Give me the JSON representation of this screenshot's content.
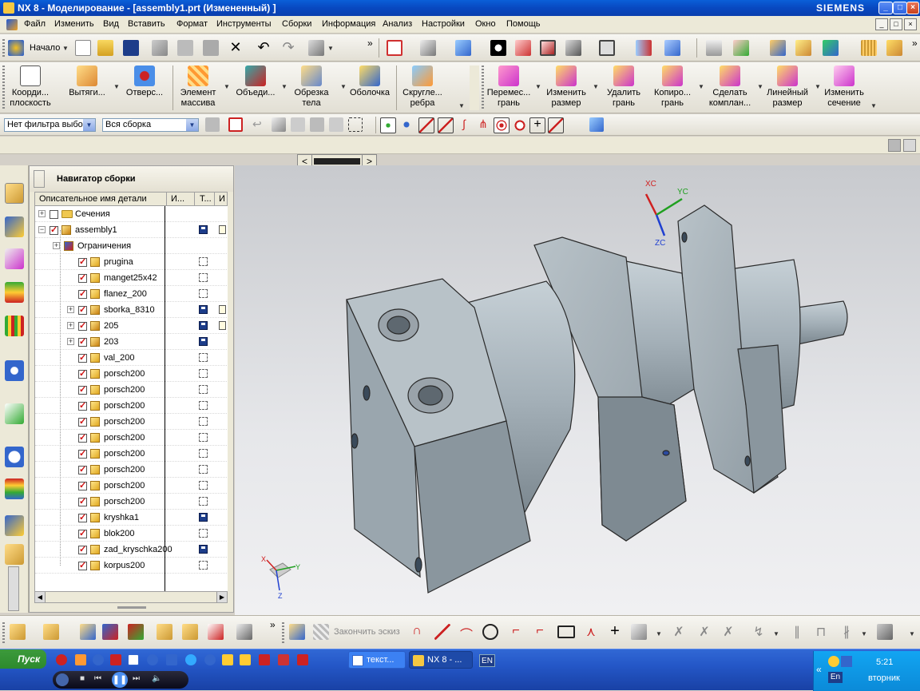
{
  "title_bar": {
    "title": "NX 8 - Моделирование - [assembly1.prt (Измененный) ]",
    "brand": "SIEMENS",
    "min": "_",
    "max": "□",
    "close": "×"
  },
  "menu": {
    "items": [
      "Файл",
      "Изменить",
      "Вид",
      "Вставить",
      "Формат",
      "Инструменты",
      "Сборки",
      "Информация",
      "Анализ",
      "Настройки",
      "Окно",
      "Помощь"
    ]
  },
  "toolbar1": {
    "start_label": "Начало",
    "more": "»"
  },
  "toolbar2": {
    "buttons": [
      {
        "label": "Коорди...\nплоскость"
      },
      {
        "label": "Вытяги..."
      },
      {
        "label": "Отверс..."
      },
      {
        "label": "Элемент\nмассива"
      },
      {
        "label": "Объеди..."
      },
      {
        "label": "Обрезка\nтела"
      },
      {
        "label": "Оболочка"
      },
      {
        "label": "Скругле...\nребра"
      },
      {
        "label": "Перемес...\nгрань"
      },
      {
        "label": "Изменить\nразмер"
      },
      {
        "label": "Удалить\nгрань"
      },
      {
        "label": "Копиро...\nгрань"
      },
      {
        "label": "Сделать\nкомплан..."
      },
      {
        "label": "Линейный\nразмер"
      },
      {
        "label": "Изменить\nсечение"
      }
    ]
  },
  "selection_bar": {
    "filter": "Нет фильтра выбо",
    "scope": "Вся сборка"
  },
  "navigator": {
    "title": "Навигатор сборки",
    "columns": [
      "Описательное имя детали",
      "И...",
      "Т...",
      "И"
    ],
    "rows": [
      {
        "name": "Сечения",
        "kind": "folder",
        "checked": false,
        "expander": "+",
        "status": "",
        "doc": false
      },
      {
        "name": "assembly1",
        "kind": "asm",
        "checked": true,
        "expander": "−",
        "status": "save",
        "doc": true
      },
      {
        "name": "Ограничения",
        "kind": "constraint",
        "checked": false,
        "expander": "+",
        "status": "",
        "doc": false
      },
      {
        "name": "prugina",
        "kind": "part",
        "checked": true,
        "expander": "",
        "status": "empty",
        "doc": false
      },
      {
        "name": "manget25x42",
        "kind": "part",
        "checked": true,
        "expander": "",
        "status": "empty",
        "doc": false
      },
      {
        "name": "flanez_200",
        "kind": "part",
        "checked": true,
        "expander": "",
        "status": "empty",
        "doc": false
      },
      {
        "name": "sborka_8310",
        "kind": "asm",
        "checked": true,
        "expander": "+",
        "status": "save",
        "doc": true
      },
      {
        "name": "205",
        "kind": "asm",
        "checked": true,
        "expander": "+",
        "status": "save",
        "doc": true
      },
      {
        "name": "203",
        "kind": "asm",
        "checked": true,
        "expander": "+",
        "status": "save",
        "doc": false
      },
      {
        "name": "val_200",
        "kind": "part",
        "checked": true,
        "expander": "",
        "status": "empty",
        "doc": false
      },
      {
        "name": "porsch200",
        "kind": "part",
        "checked": true,
        "expander": "",
        "status": "empty",
        "doc": false
      },
      {
        "name": "porsch200",
        "kind": "part",
        "checked": true,
        "expander": "",
        "status": "empty",
        "doc": false
      },
      {
        "name": "porsch200",
        "kind": "part",
        "checked": true,
        "expander": "",
        "status": "empty",
        "doc": false
      },
      {
        "name": "porsch200",
        "kind": "part",
        "checked": true,
        "expander": "",
        "status": "empty",
        "doc": false
      },
      {
        "name": "porsch200",
        "kind": "part",
        "checked": true,
        "expander": "",
        "status": "empty",
        "doc": false
      },
      {
        "name": "porsch200",
        "kind": "part",
        "checked": true,
        "expander": "",
        "status": "empty",
        "doc": false
      },
      {
        "name": "porsch200",
        "kind": "part",
        "checked": true,
        "expander": "",
        "status": "empty",
        "doc": false
      },
      {
        "name": "porsch200",
        "kind": "part",
        "checked": true,
        "expander": "",
        "status": "empty",
        "doc": false
      },
      {
        "name": "porsch200",
        "kind": "part",
        "checked": true,
        "expander": "",
        "status": "empty",
        "doc": false
      },
      {
        "name": "kryshka1",
        "kind": "part",
        "checked": true,
        "expander": "",
        "status": "save",
        "doc": false
      },
      {
        "name": "blok200",
        "kind": "part",
        "checked": true,
        "expander": "",
        "status": "empty",
        "doc": false
      },
      {
        "name": "zad_kryschka200",
        "kind": "part",
        "checked": true,
        "expander": "",
        "status": "save",
        "doc": false
      },
      {
        "name": "korpus200",
        "kind": "part",
        "checked": true,
        "expander": "",
        "status": "empty",
        "doc": false
      }
    ]
  },
  "viewport": {
    "triad_labels": {
      "xc": "XC",
      "yc": "YC",
      "zc": "ZC",
      "x": "X",
      "y": "Y",
      "z": "Z"
    },
    "colors": {
      "part": "#a9b4bc",
      "edge": "#2a2a2a",
      "xaxis": "#d02020",
      "yaxis": "#20a020",
      "zaxis": "#2040d0"
    }
  },
  "bottom_toolbar": {
    "finish_sketch": "Закончить эскиз",
    "more": "»"
  },
  "taskbar": {
    "start": "Пуск",
    "tasks": [
      {
        "label": "текст..."
      },
      {
        "label": "NX 8 - ..."
      }
    ],
    "lang": "EN",
    "tray_lang": "En",
    "time": "5:21",
    "day": "вторник",
    "chevron": "«"
  }
}
